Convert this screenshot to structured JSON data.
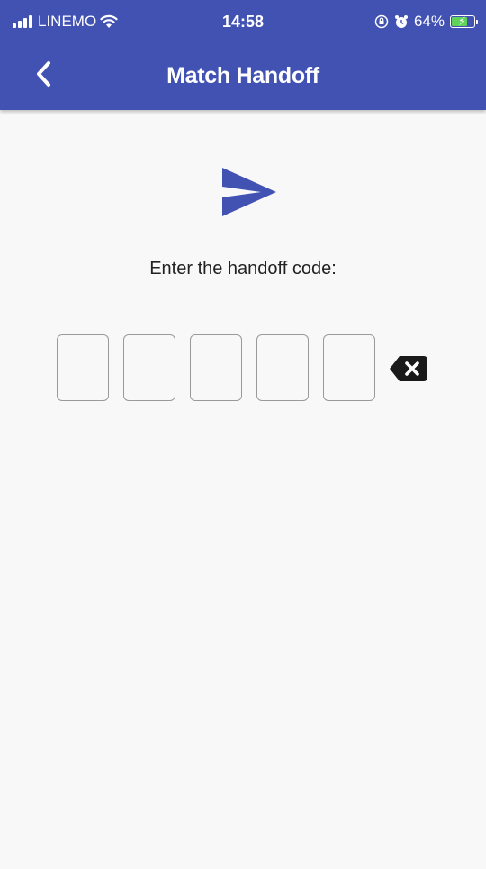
{
  "status_bar": {
    "carrier": "LINEMO",
    "time": "14:58",
    "battery_percent": "64%",
    "icons": [
      "signal-icon",
      "wifi-icon",
      "orientation-lock-icon",
      "alarm-icon",
      "battery-charging-icon"
    ]
  },
  "header": {
    "title": "Match Handoff",
    "back_icon": "chevron-left-icon",
    "background_color": "#4152b3"
  },
  "main": {
    "hero_icon": "send-icon",
    "prompt": "Enter the handoff code:",
    "code_inputs": [
      {
        "value": ""
      },
      {
        "value": ""
      },
      {
        "value": ""
      },
      {
        "value": ""
      },
      {
        "value": ""
      }
    ],
    "clear_icon": "backspace-icon"
  },
  "colors": {
    "accent": "#4152b3",
    "background": "#f8f8f8",
    "input_border": "#9a9a9a"
  }
}
